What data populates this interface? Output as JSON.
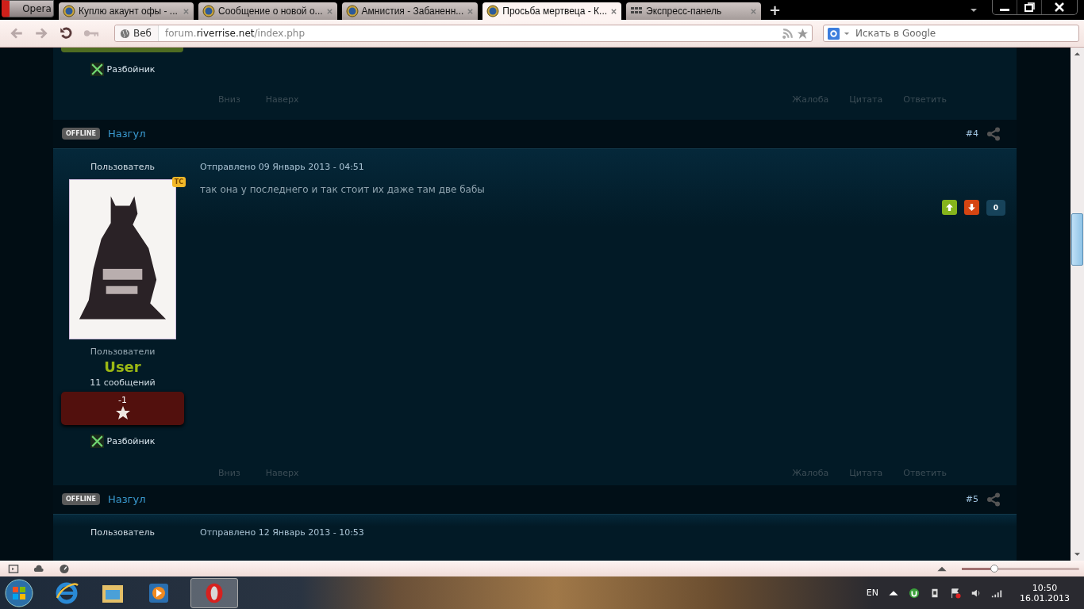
{
  "browser": {
    "menu_button": "Opera",
    "tabs": [
      {
        "title": "Куплю акаунт офы - ...",
        "selected": false,
        "kind": "site"
      },
      {
        "title": "Сообщение о новой о...",
        "selected": false,
        "kind": "site"
      },
      {
        "title": "Амнистия - Забаненн...",
        "selected": false,
        "kind": "site"
      },
      {
        "title": "Просьба мертвеца - К...",
        "selected": true,
        "kind": "site"
      },
      {
        "title": "Экспресс-панель",
        "selected": false,
        "kind": "speed-dial"
      }
    ],
    "new_tab": "+",
    "address": {
      "label": "Веб",
      "url_prefix": "forum.",
      "url_domain": "riverrise.net",
      "url_path": "/index.php"
    },
    "search": {
      "placeholder": "Искать в Google"
    }
  },
  "top_post": {
    "class_name": "Разбойник",
    "nav_links": [
      "Вниз",
      "Наверх"
    ],
    "actions": [
      "Жалоба",
      "Цитата",
      "Ответить"
    ]
  },
  "posts": [
    {
      "status": "OFFLINE",
      "author": "Назгул",
      "number": "#4",
      "role": "Пользователь",
      "date": "Отправлено 09 Январь 2013 - 04:51",
      "badge": "ТС",
      "text": "так она у последнего и так стоит их даже там две бабы",
      "group": "Пользователи",
      "group_badge": "User",
      "post_count": "11 сообщений",
      "reputation": "-1",
      "class_name": "Разбойник",
      "votes": "0",
      "nav_links": [
        "Вниз",
        "Наверх"
      ],
      "actions": [
        "Жалоба",
        "Цитата",
        "Ответить"
      ]
    },
    {
      "status": "OFFLINE",
      "author": "Назгул",
      "number": "#5",
      "role": "Пользователь",
      "date": "Отправлено 12 Январь 2013 - 10:53"
    }
  ],
  "statusbar": {
    "zoom": {
      "level": 0.28
    }
  },
  "taskbar": {
    "language": "EN",
    "time": "10:50",
    "date": "16.01.2013"
  }
}
